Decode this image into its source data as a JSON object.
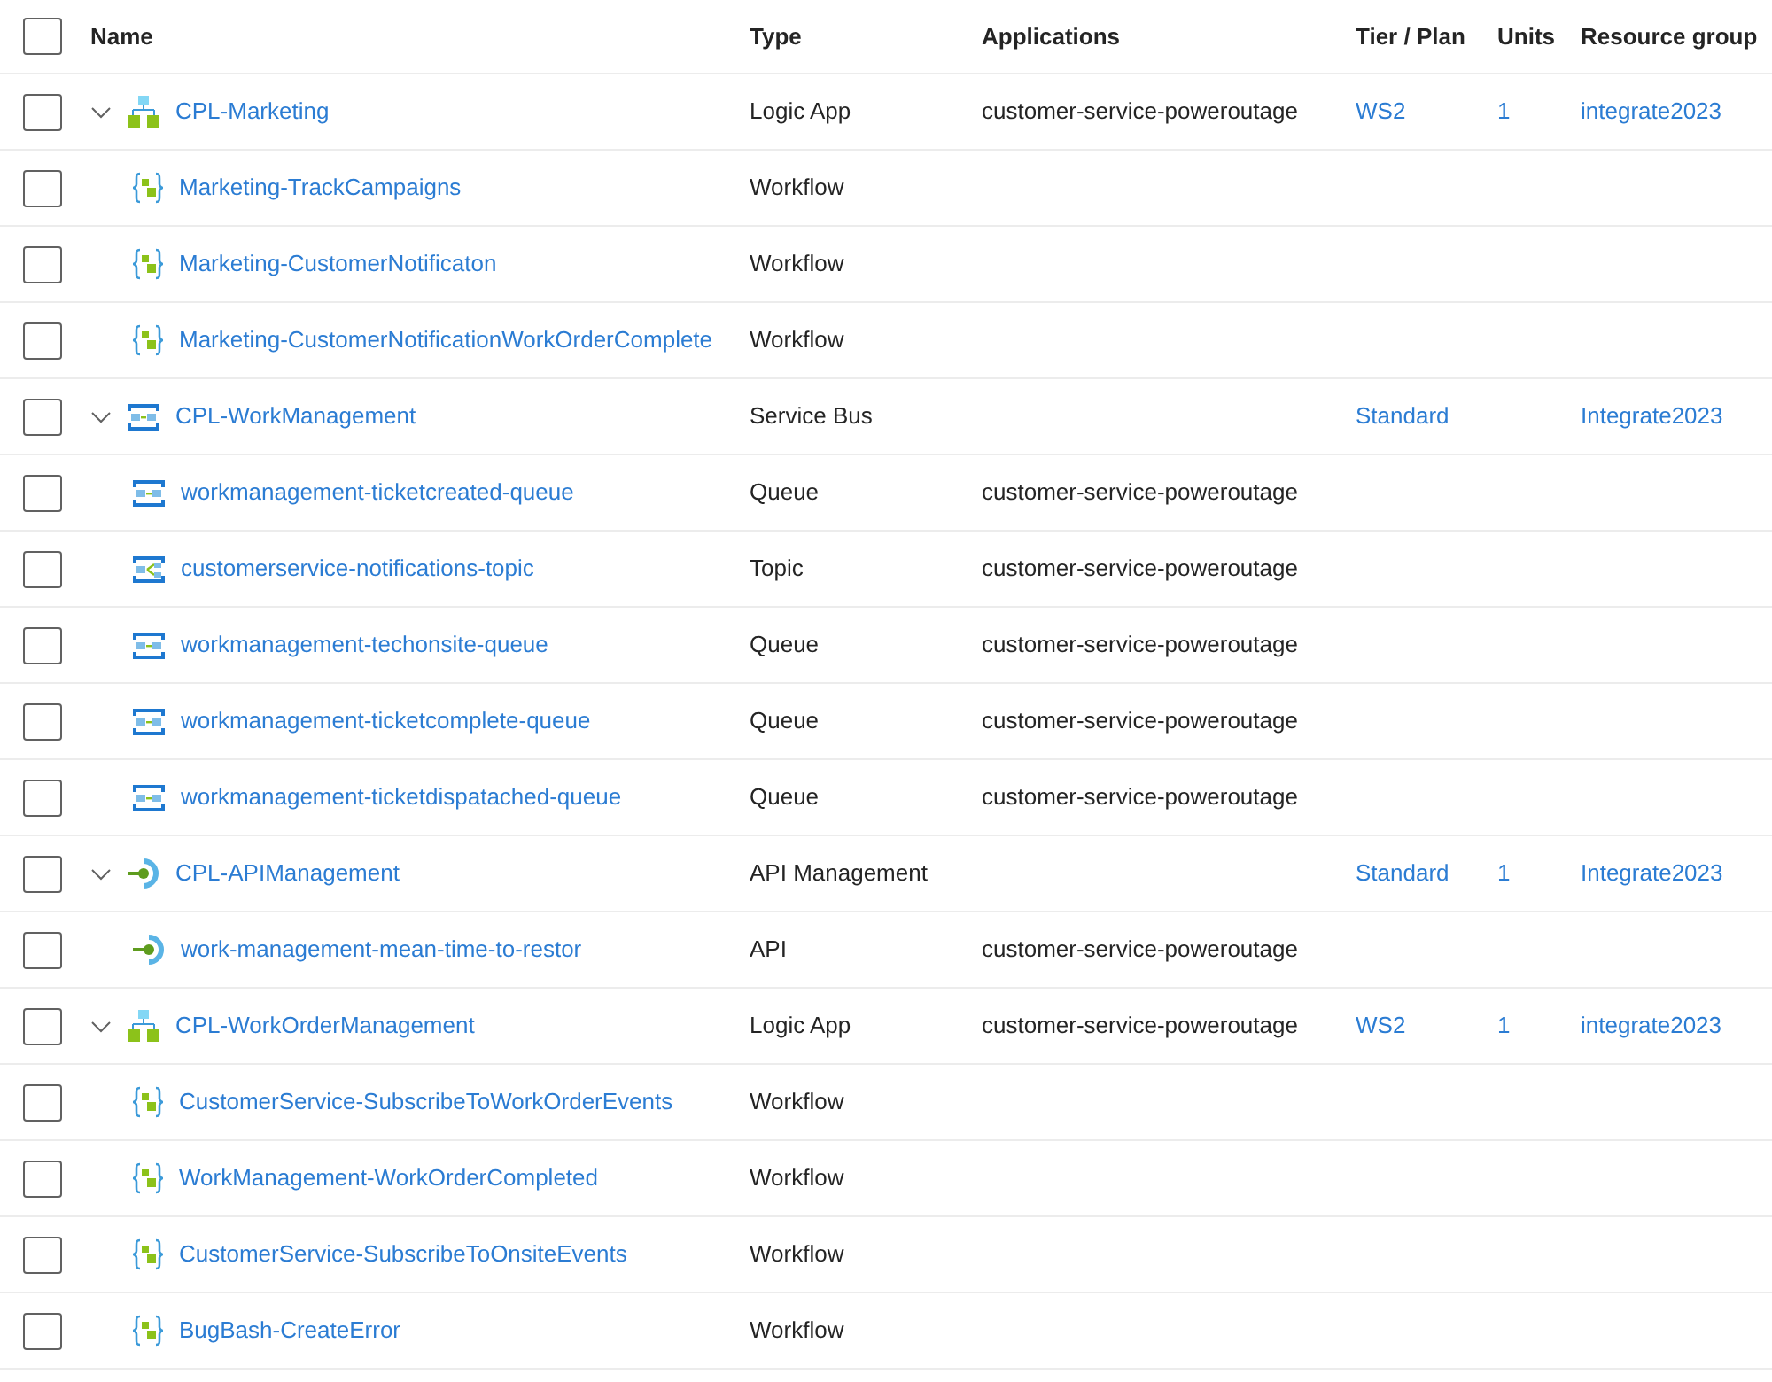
{
  "header": {
    "checked": false,
    "columns": [
      "Name",
      "Type",
      "Applications",
      "Tier / Plan",
      "Units",
      "Resource group"
    ]
  },
  "groups": [
    {
      "kind": "logic_app",
      "name": "CPL-Marketing",
      "type": "Logic App",
      "application": "customer-service-poweroutage",
      "tier": "WS2",
      "units": "1",
      "resource_group": "integrate2023",
      "expanded": true,
      "checked": false,
      "children": [
        {
          "kind": "workflow",
          "name": "Marketing-TrackCampaigns",
          "type": "Workflow",
          "checked": false
        },
        {
          "kind": "workflow",
          "name": "Marketing-CustomerNotificaton",
          "type": "Workflow",
          "checked": false
        },
        {
          "kind": "workflow",
          "name": "Marketing-CustomerNotificationWorkOrderComplete",
          "type": "Workflow",
          "checked": false
        }
      ]
    },
    {
      "kind": "service_bus",
      "name": "CPL-WorkManagement",
      "type": "Service Bus",
      "tier": "Standard",
      "resource_group": "Integrate2023",
      "expanded": true,
      "checked": false,
      "children": [
        {
          "kind": "queue",
          "name": "workmanagement-ticketcreated-queue",
          "type": "Queue",
          "application": "customer-service-poweroutage",
          "checked": false
        },
        {
          "kind": "topic",
          "name": "customerservice-notifications-topic",
          "type": "Topic",
          "application": "customer-service-poweroutage",
          "checked": false
        },
        {
          "kind": "queue",
          "name": "workmanagement-techonsite-queue",
          "type": "Queue",
          "application": "customer-service-poweroutage",
          "checked": false
        },
        {
          "kind": "queue",
          "name": "workmanagement-ticketcomplete-queue",
          "type": "Queue",
          "application": "customer-service-poweroutage",
          "checked": false
        },
        {
          "kind": "queue",
          "name": "workmanagement-ticketdispatached-queue",
          "type": "Queue",
          "application": "customer-service-poweroutage",
          "checked": false
        }
      ]
    },
    {
      "kind": "api_management",
      "name": "CPL-APIManagement",
      "type": "API Management",
      "tier": "Standard",
      "units": "1",
      "resource_group": "Integrate2023",
      "expanded": true,
      "checked": false,
      "children": [
        {
          "kind": "api",
          "name": "work-management-mean-time-to-restor",
          "type": "API",
          "application": "customer-service-poweroutage",
          "checked": false
        }
      ]
    },
    {
      "kind": "logic_app",
      "name": "CPL-WorkOrderManagement",
      "type": "Logic App",
      "application": "customer-service-poweroutage",
      "tier": "WS2",
      "units": "1",
      "resource_group": "integrate2023",
      "expanded": true,
      "checked": false,
      "children": [
        {
          "kind": "workflow",
          "name": "CustomerService-SubscribeToWorkOrderEvents",
          "type": "Workflow",
          "checked": false
        },
        {
          "kind": "workflow",
          "name": "WorkManagement-WorkOrderCompleted",
          "type": "Workflow",
          "checked": false
        },
        {
          "kind": "workflow",
          "name": "CustomerService-SubscribeToOnsiteEvents",
          "type": "Workflow",
          "checked": false
        },
        {
          "kind": "workflow",
          "name": "BugBash-CreateError",
          "type": "Workflow",
          "checked": false
        }
      ]
    }
  ]
}
